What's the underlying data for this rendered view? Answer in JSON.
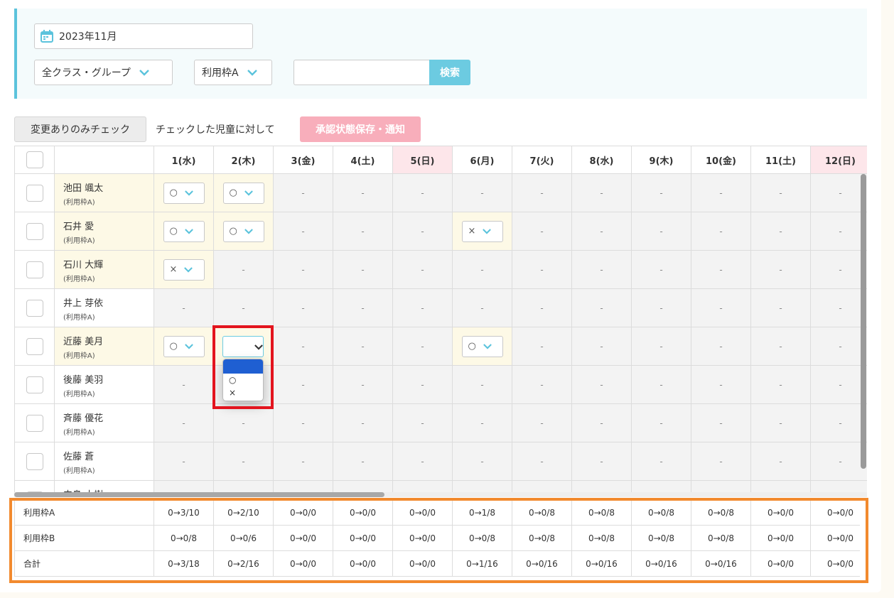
{
  "filters": {
    "month": "2023年11月",
    "class_select": "全クラス・グループ",
    "quota_select": "利用枠A",
    "search_value": "",
    "search_button": "検索"
  },
  "actions": {
    "changed_only_button": "変更ありのみチェック",
    "checked_label": "チェックした児童に対して",
    "save_notify_button": "承認状態保存・通知"
  },
  "days": [
    {
      "label": "1(水)",
      "sunday": false
    },
    {
      "label": "2(木)",
      "sunday": false
    },
    {
      "label": "3(金)",
      "sunday": false
    },
    {
      "label": "4(土)",
      "sunday": false
    },
    {
      "label": "5(日)",
      "sunday": true
    },
    {
      "label": "6(月)",
      "sunday": false
    },
    {
      "label": "7(火)",
      "sunday": false
    },
    {
      "label": "8(水)",
      "sunday": false
    },
    {
      "label": "9(木)",
      "sunday": false
    },
    {
      "label": "10(金)",
      "sunday": false
    },
    {
      "label": "11(土)",
      "sunday": false
    },
    {
      "label": "12(日)",
      "sunday": true
    }
  ],
  "dash": "-",
  "children": [
    {
      "name": "池田 颯太",
      "group": "(利用枠A)",
      "highlight": true,
      "cells": [
        "○",
        "○",
        null,
        null,
        null,
        null,
        null,
        null,
        null,
        null,
        null,
        null
      ]
    },
    {
      "name": "石井 愛",
      "group": "(利用枠A)",
      "highlight": true,
      "cells": [
        "○",
        "○",
        null,
        null,
        null,
        "×",
        null,
        null,
        null,
        null,
        null,
        null
      ]
    },
    {
      "name": "石川 大輝",
      "group": "(利用枠A)",
      "highlight": true,
      "cells": [
        "×",
        null,
        null,
        null,
        null,
        null,
        null,
        null,
        null,
        null,
        null,
        null
      ]
    },
    {
      "name": "井上 芽依",
      "group": "(利用枠A)",
      "highlight": false,
      "cells": [
        null,
        null,
        null,
        null,
        null,
        null,
        null,
        null,
        null,
        null,
        null,
        null
      ]
    },
    {
      "name": "近藤 美月",
      "group": "(利用枠A)",
      "highlight": true,
      "cells": [
        "○",
        "",
        null,
        null,
        null,
        "○",
        null,
        null,
        null,
        null,
        null,
        null
      ]
    },
    {
      "name": "後藤 美羽",
      "group": "(利用枠A)",
      "highlight": false,
      "cells": [
        null,
        null,
        null,
        null,
        null,
        null,
        null,
        null,
        null,
        null,
        null,
        null
      ]
    },
    {
      "name": "斉藤 優花",
      "group": "(利用枠A)",
      "highlight": false,
      "cells": [
        null,
        null,
        null,
        null,
        null,
        null,
        null,
        null,
        null,
        null,
        null,
        null
      ]
    },
    {
      "name": "佐藤 蒼",
      "group": "(利用枠A)",
      "highlight": false,
      "cells": [
        null,
        null,
        null,
        null,
        null,
        null,
        null,
        null,
        null,
        null,
        null,
        null
      ]
    },
    {
      "name": "中島 大樹",
      "group": "(利用枠A)",
      "highlight": false,
      "cells": [
        null,
        null,
        null,
        null,
        null,
        null,
        null,
        null,
        null,
        null,
        null,
        null
      ]
    }
  ],
  "dropdown_options": [
    "",
    "○",
    "×"
  ],
  "summary": [
    {
      "label": "利用枠A",
      "values": [
        "0→3/10",
        "0→2/10",
        "0→0/0",
        "0→0/0",
        "0→0/0",
        "0→1/8",
        "0→0/8",
        "0→0/8",
        "0→0/8",
        "0→0/8",
        "0→0/0",
        "0→0/0"
      ]
    },
    {
      "label": "利用枠B",
      "values": [
        "0→0/8",
        "0→0/6",
        "0→0/0",
        "0→0/0",
        "0→0/0",
        "0→0/8",
        "0→0/8",
        "0→0/8",
        "0→0/8",
        "0→0/8",
        "0→0/0",
        "0→0/0"
      ]
    },
    {
      "label": "合計",
      "values": [
        "0→3/18",
        "0→2/16",
        "0→0/0",
        "0→0/0",
        "0→0/0",
        "0→1/16",
        "0→0/16",
        "0→0/16",
        "0→0/16",
        "0→0/16",
        "0→0/0",
        "0→0/0"
      ]
    }
  ],
  "colors": {
    "accent": "#6ccbe1",
    "sunday_bg": "#fde6ea",
    "highlight_bg": "#fdf9e6",
    "save_button": "#f8aebb",
    "annotation_red": "#e3141e",
    "annotation_orange": "#f28a2e"
  }
}
